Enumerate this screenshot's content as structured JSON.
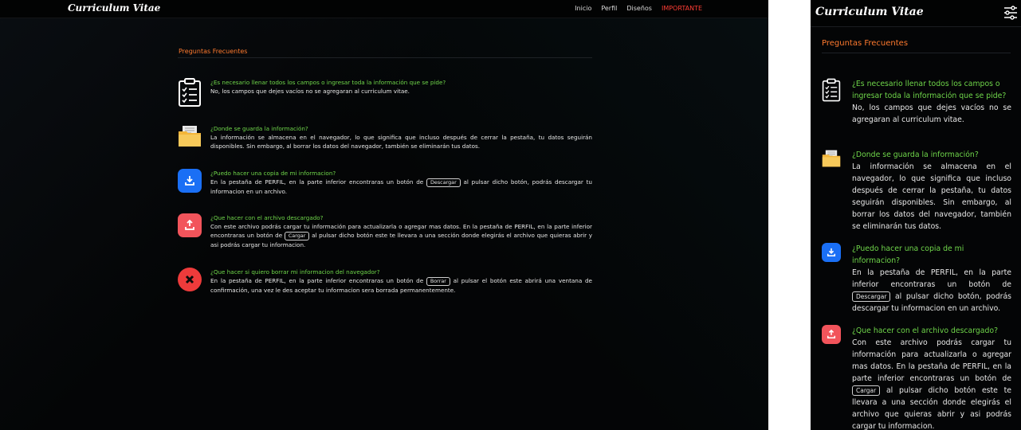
{
  "brand": "Curriculum Vitae",
  "nav": {
    "inicio": "Inicio",
    "perfil": "Perfil",
    "disenos": "Diseños",
    "importante": "IMPORTANTE"
  },
  "faq_title": "Preguntas Frecuentes",
  "faqs": [
    {
      "question": "¿Es necesario llenar todos los campos o ingresar toda la información que se pide?",
      "answer": "No, los campos que dejes vacíos no se agregaran al curriculum vitae.",
      "icon": "clipboard-checklist-icon"
    },
    {
      "question": "¿Donde se guarda la información?",
      "answer": "La información se almacena en el navegador, lo que significa que incluso después de cerrar la pestaña, tu datos seguirán disponibles. Sin embargo, al borrar los datos del navegador, también se eliminarán tus datos.",
      "icon": "folder-icon"
    },
    {
      "question": "¿Puedo hacer una copia de mi informacion?",
      "answer_before": "En la pestaña de PERFIL, en la parte inferior encontraras un botón de",
      "button": "Descargar",
      "answer_after": "al pulsar dicho botón, podrás descargar tu informacion en un archivo.",
      "icon": "download-icon"
    },
    {
      "question": "¿Que hacer con el archivo descargado?",
      "answer_before": "Con este archivo podrás cargar tu información para actualizarla o agregar mas datos. En la pestaña de PERFIL, en la parte inferior encontraras un botón de",
      "button": "Cargar",
      "answer_after": "al pulsar dicho botón este te llevara a una sección donde elegirás el archivo que quieras abrir y asi podrás cargar tu informacion.",
      "icon": "upload-icon"
    },
    {
      "question": "¿Que hacer si quiero borrar mi informacion del navegador?",
      "answer_before": "En la pestaña de PERFIL, en la parte inferior encontraras un botón de",
      "button": "Borrar",
      "answer_after": "al pulsar el botón este abrirá una ventana de confirmación, una vez le des aceptar tu informacion sera borrada permanentemente.",
      "icon": "close-x-icon"
    }
  ],
  "colors": {
    "question": "#6fd64a",
    "title": "#ff7a2e",
    "important": "#ff3d34",
    "download": "#1a6ff5",
    "upload": "#f2545b",
    "delete": "#ee3b3b"
  },
  "mobile_menu_icon": "sliders-menu-icon"
}
